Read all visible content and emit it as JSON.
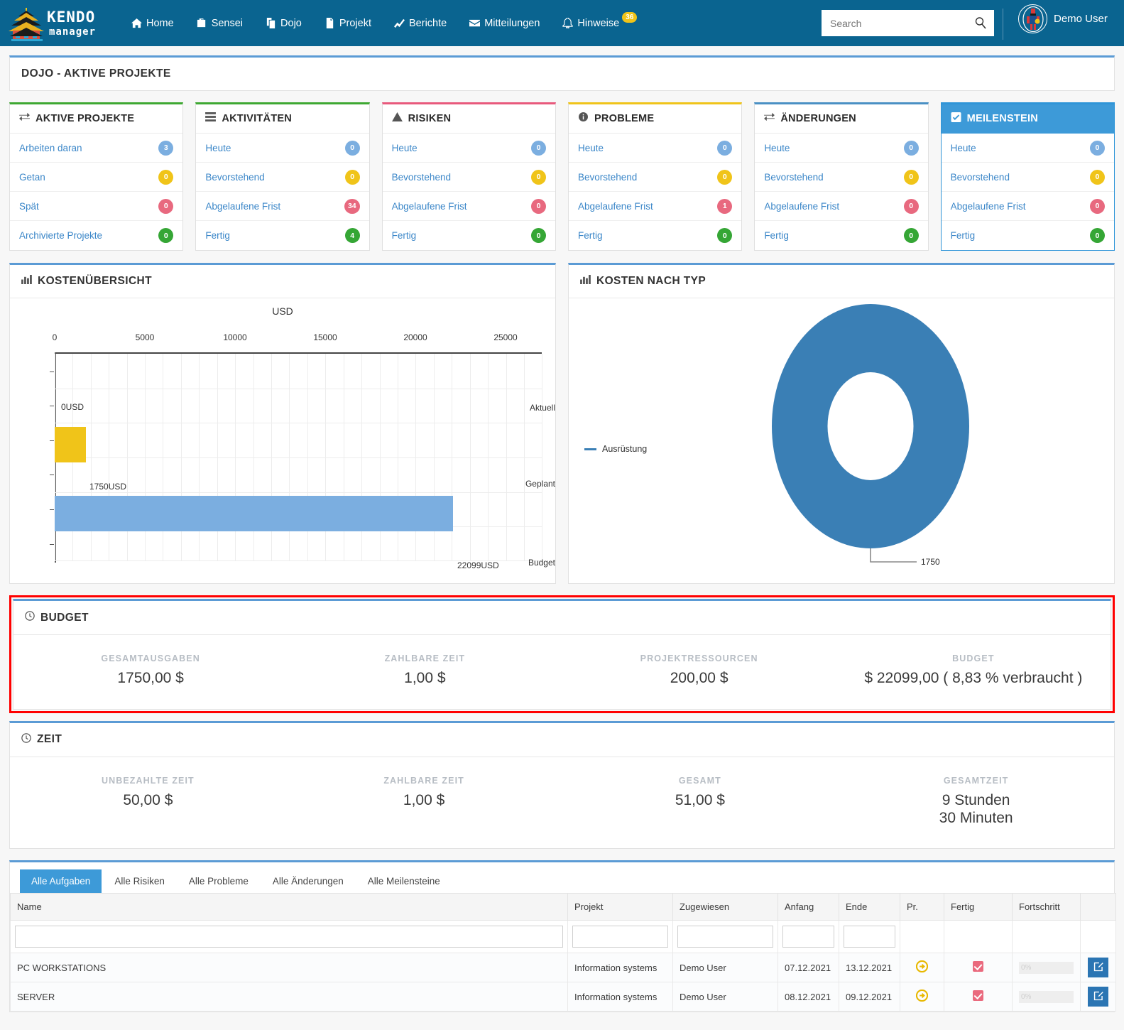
{
  "header": {
    "logo_alt": "KENDO manager",
    "logo_line1": "KENDO",
    "logo_line2": "manager",
    "nav": [
      {
        "label": "Home",
        "icon": "home-icon"
      },
      {
        "label": "Sensei",
        "icon": "briefcase-icon"
      },
      {
        "label": "Dojo",
        "icon": "copy-icon"
      },
      {
        "label": "Projekt",
        "icon": "file-icon"
      },
      {
        "label": "Berichte",
        "icon": "chart-line-icon"
      },
      {
        "label": "Mitteilungen",
        "icon": "envelope-icon"
      },
      {
        "label": "Hinweise",
        "icon": "bell-icon",
        "badge": "36"
      }
    ],
    "search": {
      "placeholder": "Search",
      "value": ""
    },
    "user": {
      "name": "Demo User"
    }
  },
  "page_title": "DOJO - AKTIVE PROJEKTE",
  "cards": [
    {
      "title": "AKTIVE PROJEKTE",
      "icon": "exchange-icon",
      "accent": "#3ea832",
      "style": "c-green",
      "rows": [
        {
          "label": "Arbeiten daran",
          "value": "3",
          "color": "blue"
        },
        {
          "label": "Getan",
          "value": "0",
          "color": "yellow"
        },
        {
          "label": "Spät",
          "value": "0",
          "color": "red"
        },
        {
          "label": "Archivierte Projekte",
          "value": "0",
          "color": "green"
        }
      ]
    },
    {
      "title": "AKTIVITÄTEN",
      "icon": "list-icon",
      "accent": "#3ea832",
      "style": "c-green",
      "rows": [
        {
          "label": "Heute",
          "value": "0",
          "color": "blue"
        },
        {
          "label": "Bevorstehend",
          "value": "0",
          "color": "yellow"
        },
        {
          "label": "Abgelaufene Frist",
          "value": "34",
          "color": "red"
        },
        {
          "label": "Fertig",
          "value": "4",
          "color": "green"
        }
      ]
    },
    {
      "title": "RISIKEN",
      "icon": "warning-icon",
      "accent": "#e8597c",
      "style": "c-pink",
      "rows": [
        {
          "label": "Heute",
          "value": "0",
          "color": "blue"
        },
        {
          "label": "Bevorstehend",
          "value": "0",
          "color": "yellow"
        },
        {
          "label": "Abgelaufene Frist",
          "value": "0",
          "color": "red"
        },
        {
          "label": "Fertig",
          "value": "0",
          "color": "green"
        }
      ]
    },
    {
      "title": "PROBLEME",
      "icon": "info-icon",
      "accent": "#f0c419",
      "style": "c-yellow",
      "rows": [
        {
          "label": "Heute",
          "value": "0",
          "color": "blue"
        },
        {
          "label": "Bevorstehend",
          "value": "0",
          "color": "yellow"
        },
        {
          "label": "Abgelaufene Frist",
          "value": "1",
          "color": "red"
        },
        {
          "label": "Fertig",
          "value": "0",
          "color": "green"
        }
      ]
    },
    {
      "title": "ÄNDERUNGEN",
      "icon": "exchange-icon",
      "accent": "#4a90c4",
      "style": "c-blue",
      "rows": [
        {
          "label": "Heute",
          "value": "0",
          "color": "blue"
        },
        {
          "label": "Bevorstehend",
          "value": "0",
          "color": "yellow"
        },
        {
          "label": "Abgelaufene Frist",
          "value": "0",
          "color": "red"
        },
        {
          "label": "Fertig",
          "value": "0",
          "color": "green"
        }
      ]
    },
    {
      "title": "MEILENSTEIN",
      "icon": "check-square-icon",
      "accent": "#2f95d8",
      "style": "c-sel",
      "rows": [
        {
          "label": "Heute",
          "value": "0",
          "color": "blue"
        },
        {
          "label": "Bevorstehend",
          "value": "0",
          "color": "yellow"
        },
        {
          "label": "Abgelaufene Frist",
          "value": "0",
          "color": "red"
        },
        {
          "label": "Fertig",
          "value": "0",
          "color": "green"
        }
      ]
    }
  ],
  "cost_panel_title": "KOSTENÜBERSICHT",
  "type_panel_title": "KOSTEN NACH TYP",
  "chart_data": [
    {
      "type": "bar",
      "orientation": "horizontal",
      "title": "USD",
      "xlabel": "",
      "ylabel": "",
      "categories": [
        "Aktuell",
        "Geplant",
        "Budget"
      ],
      "values": [
        0,
        1750,
        22099
      ],
      "data_labels": [
        "0USD",
        "1750USD",
        "22099USD"
      ],
      "colors": [
        "#7baee0",
        "#f0c419",
        "#7baee0"
      ],
      "xticks": [
        0,
        5000,
        10000,
        15000,
        20000,
        25000
      ],
      "xtick_labels": [
        "0",
        "5000",
        "10000",
        "15000",
        "20000",
        "25000"
      ],
      "xlim": [
        0,
        27000
      ],
      "grid": true,
      "legend": false
    },
    {
      "type": "pie",
      "variant": "donut",
      "title": "",
      "labels": [
        "Ausrüstung"
      ],
      "values": [
        1750
      ],
      "data_labels": [
        "1750"
      ],
      "colors": [
        "#3a7fb5"
      ],
      "legend": true,
      "legend_position": "left"
    }
  ],
  "budget": {
    "title": "BUDGET",
    "icon": "clock-icon",
    "cells": [
      {
        "label": "GESAMTAUSGABEN",
        "value": "1750,00 $"
      },
      {
        "label": "ZAHLBARE ZEIT",
        "value": "1,00 $"
      },
      {
        "label": "PROJEKTRESSOURCEN",
        "value": "200,00 $"
      },
      {
        "label": "BUDGET",
        "value": "$ 22099,00 ( 8,83 % verbraucht )"
      }
    ]
  },
  "time": {
    "title": "ZEIT",
    "icon": "clock-icon",
    "cells": [
      {
        "label": "UNBEZAHLTE ZEIT",
        "value": "50,00 $"
      },
      {
        "label": "ZAHLBARE ZEIT",
        "value": "1,00 $"
      },
      {
        "label": "GESAMT",
        "value": "51,00 $"
      },
      {
        "label": "GESAMTZEIT",
        "value": "9 Stunden",
        "value2": "30 Minuten"
      }
    ]
  },
  "bottom": {
    "tabs": [
      {
        "label": "Alle Aufgaben",
        "active": true
      },
      {
        "label": "Alle Risiken",
        "active": false
      },
      {
        "label": "Alle Probleme",
        "active": false
      },
      {
        "label": "Alle Änderungen",
        "active": false
      },
      {
        "label": "Alle Meilensteine",
        "active": false
      }
    ],
    "columns": [
      "Name",
      "Projekt",
      "Zugewiesen",
      "Anfang",
      "Ende",
      "Pr.",
      "Fertig",
      "Fortschritt",
      ""
    ],
    "filters": [
      "",
      "",
      "",
      "",
      "",
      null,
      null,
      null,
      null
    ],
    "rows": [
      {
        "name": "PC WORKSTATIONS",
        "projekt": "Information systems",
        "zugewiesen": "Demo User",
        "anfang": "07.12.2021",
        "ende": "13.12.2021",
        "prioritaet": "arrow-right-icon",
        "fertig": "checked",
        "fortschritt": "0%",
        "edit": "edit-icon"
      },
      {
        "name": "SERVER",
        "projekt": "Information systems",
        "zugewiesen": "Demo User",
        "anfang": "08.12.2021",
        "ende": "09.12.2021",
        "prioritaet": "arrow-right-icon",
        "fertig": "checked",
        "fortschritt": "0%",
        "edit": "edit-icon"
      }
    ]
  },
  "colors": {
    "header_blue": "#0a6490",
    "accent_blue": "#3d9ad8",
    "panel_top": "#5b9bd5",
    "highlight_red": "#ff0000",
    "bar_blue": "#7baee0",
    "bar_yellow": "#f0c419",
    "donut_blue": "#3a7fb5"
  }
}
